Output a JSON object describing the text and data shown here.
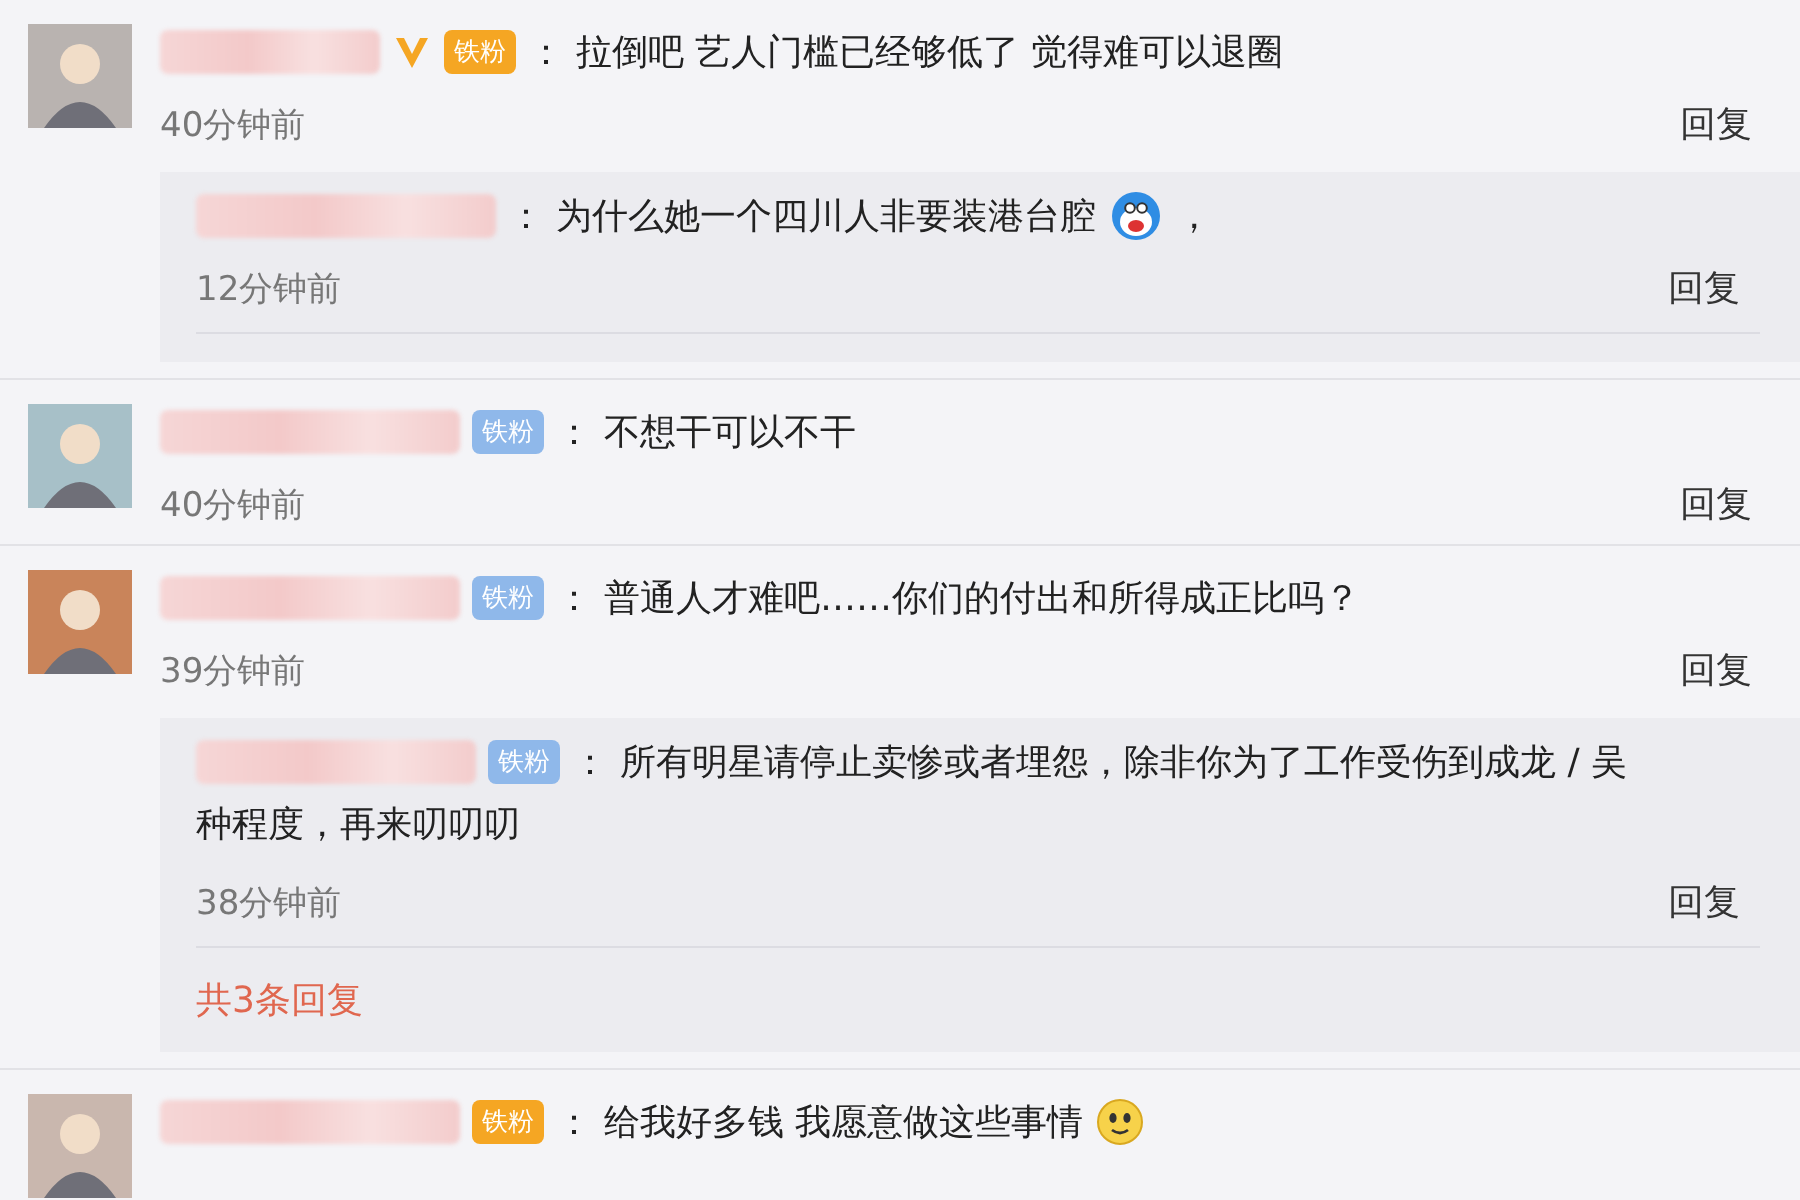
{
  "comments": [
    {
      "verified": true,
      "badge": {
        "label": "铁粉",
        "kind": "orange"
      },
      "separator": "：",
      "text": "拉倒吧 艺人门槛已经够低了 觉得难可以退圈",
      "trailing_icon": false,
      "time": "40分钟前",
      "reply_label": "回复",
      "replies": [
        {
          "separator": "：",
          "lines": [
            "为什么她一个四川人非要装港台腔"
          ],
          "trailing_icon": true,
          "text_after_icon": "，",
          "time": "12分钟前",
          "reply_label": "回复"
        }
      ]
    },
    {
      "verified": false,
      "badge": {
        "label": "铁粉",
        "kind": "blue"
      },
      "separator": "：",
      "text": "不想干可以不干",
      "trailing_icon": false,
      "time": "40分钟前",
      "reply_label": "回复"
    },
    {
      "verified": false,
      "badge": {
        "label": "铁粉",
        "kind": "blue"
      },
      "separator": "：",
      "text": "普通人才难吧……你们的付出和所得成正比吗？",
      "trailing_icon": false,
      "time": "39分钟前",
      "reply_label": "回复",
      "replies": [
        {
          "badge": {
            "label": "铁粉",
            "kind": "blue"
          },
          "separator": "：",
          "lines": [
            "所有明星请停止卖惨或者埋怨，除非你为了工作受伤到成龙 / 吴",
            "种程度，再来叨叨叨"
          ],
          "trailing_icon": false,
          "time": "38分钟前",
          "reply_label": "回复"
        }
      ],
      "more_replies": "共3条回复"
    },
    {
      "verified": false,
      "badge": {
        "label": "铁粉",
        "kind": "orange"
      },
      "separator": "：",
      "text": "给我好多钱 我愿意做这些事情",
      "trailing_icon": true
    }
  ]
}
